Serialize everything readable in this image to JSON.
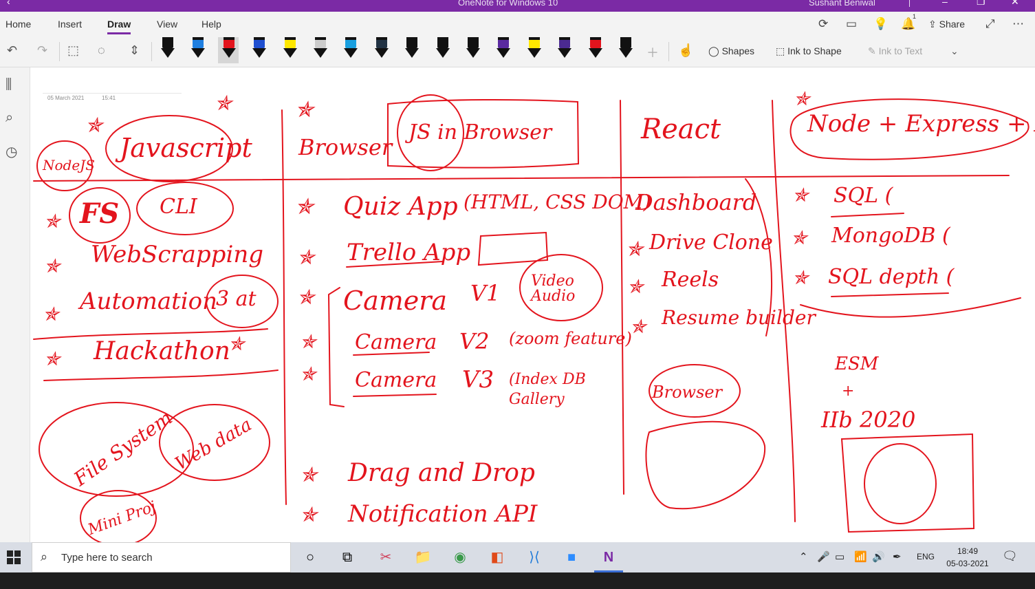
{
  "window": {
    "title": "OneNote for Windows 10",
    "user": "Sushant Beniwal"
  },
  "ribbon": {
    "tabs": [
      "Home",
      "Insert",
      "Draw",
      "View",
      "Help"
    ],
    "active_tab": "Draw",
    "share_label": "Share",
    "notification_count": "1"
  },
  "toolbar": {
    "shapes_label": "Shapes",
    "ink_to_shape_label": "Ink to Shape",
    "ink_to_text_label": "Ink to Text",
    "pen_colors": [
      "#111111",
      "#1f7fe0",
      "#e3141d",
      "#1f4fd0",
      "#ffe800",
      "#cccccc",
      "#1aa0e0",
      "#223344",
      "#111111",
      "#111111",
      "#111111",
      "#5a2aa0",
      "#ffe800",
      "#4b2a90",
      "#e3141d",
      "#111111"
    ],
    "accent": "#7b2aa5"
  },
  "page": {
    "date": "05 March 2021",
    "time": "15:41",
    "ink_color": "#e3141d"
  },
  "ink": {
    "col1": [
      "Javascript",
      "NodeJS",
      "FS",
      "CLI",
      "WebScrapping",
      "Automation",
      "3 at",
      "Hackathon",
      "File System",
      "Web data",
      "Mini Proj"
    ],
    "col2": [
      "Browser",
      "JS in Browser",
      "Quiz App",
      "(HTML, CSS DOM)",
      "Trello App",
      "Camera",
      "V1",
      "Video Audio",
      "Camera",
      "V2",
      "(zoom feature)",
      "Camera",
      "V3",
      "(Index DB Gallery",
      "Drag and Drop",
      "Notification API"
    ],
    "col3": [
      "React",
      "Dashboard",
      "Drive Clone",
      "Reels",
      "Resume builder",
      "Browser"
    ],
    "col4": [
      "Node + Express + DB",
      "SQL (",
      "MongoDB (",
      "SQL depth (",
      "ESM",
      "+",
      "IIb 2020"
    ]
  },
  "taskbar": {
    "search_placeholder": "Type here to search",
    "language": "ENG",
    "time": "18:49",
    "date": "05-03-2021"
  }
}
